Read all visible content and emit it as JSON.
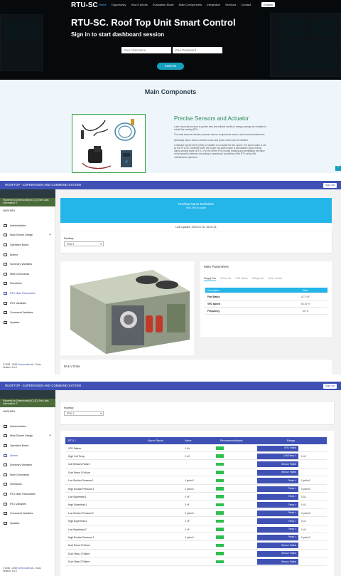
{
  "landing": {
    "brand": "RTU-SC",
    "nav": [
      "Home",
      "Opportunity",
      "How it Works",
      "Evaluation Mode",
      "Main Components",
      "Integration",
      "Services",
      "Contact"
    ],
    "language": "English",
    "title": "RTU-SC. Roof Top Unit Smart Control",
    "subtitle": "Sign in to start dashboard session",
    "username_placeholder": "Your Username",
    "password_placeholder": "Your Password",
    "signin_label": "SIGN IN",
    "components_title": "Main Componets",
    "sensors_title": "Precise Sensors and Actuator",
    "sensors_paragraphs": [
      "A set of precise sensors to get the best and reliable results in energy savings are installed to retrofit the existing RTU.",
      "The main sensors includes pressure sensor, temperature sensor, and current transformers.",
      "Optionally indoor carbon dioxide sensor and power meter can be installed.",
      "A Variable Speed Drive (VSD) is installed to modulate the fan speed. The speed value is set by the RTU-SC controller when the proper fan speed value is calculated to save energy during cooling mode of RTU. For the others RTU modes (heating and ventilating) the value of fan speed is retrieved according to operational conditions of the RTU set by the maintenance operators."
    ]
  },
  "dashboard": {
    "header_title": "ROOFTOP - SUPERVISION AND COMMAND SYSTEM",
    "signout_label": "Sign out",
    "logo_text": "Powered by Greenovate(UC) (C) Sim Labs Information IT",
    "user_label": "MARKMEN",
    "sidebar": [
      "Administration",
      "Main Screen Design",
      "Operation Board",
      "Alarms",
      "Summary Variables",
      "Main Commands",
      "Schedules",
      "RTU Main Parameters",
      "RTU Variables",
      "Command Variables",
      "Updates"
    ],
    "footer_copyright": "© 2015 - 2019",
    "footer_company": "GreenovateLab",
    "footer_rest": "- Tools",
    "footer_version": "Version: 1.6.5",
    "rooftop_label": "Rooftop:",
    "rooftop_value_1": "RTU 2",
    "rooftop_value_2": "RTU 1",
    "banner_title": "Rooftop Name Definition",
    "banner_sub": "Hold ARA no guide",
    "last_update": "Last Update: 2020-07-31 16:20:31",
    "params_title": "Main Parameters",
    "param_tabs": [
      "Supply Fan",
      "Return Air",
      "VSD Status",
      "Refrigerant",
      "Other Values"
    ],
    "param_table_header": [
      "Description",
      "Value"
    ],
    "param_rows": [
      {
        "k": "Fan Status",
        "v": "ACTIVE"
      },
      {
        "k": "VFD Speed",
        "v": "58.33 %"
      },
      {
        "k": "Frequency",
        "v": "35 Hz"
      }
    ],
    "mv_title": "M & V Data",
    "status_header": [
      "RTU 1",
      "Alarm Status",
      "Value",
      "Recommendations",
      "Range"
    ],
    "status_rows": [
      {
        "name": "VFD Failure",
        "value": "0 Hz",
        "range": "VFD Failed",
        "rv": ""
      },
      {
        "name": "High Coil Temp.",
        "value": "0 oC",
        "range": "Coil Temp >",
        "rv": "0 oC"
      },
      {
        "name": "Coil Sensors Failure",
        "value": "",
        "range": "Sensor Failed",
        "rv": ""
      },
      {
        "name": "Duct Press 1 Failure",
        "value": "",
        "range": "Sensor Failed",
        "rv": ""
      },
      {
        "name": "Low Suction Pressure 1",
        "value": "0 psi/m2",
        "range": "Press <",
        "rv": "0 psi/m2"
      },
      {
        "name": "High Suction Pressure 1",
        "value": "0 psi/m2",
        "range": "Press >",
        "rv": "0 psi/m2"
      },
      {
        "name": "Low Superheat 1",
        "value": "0 oF",
        "range": "Temp <",
        "rv": "0 oC"
      },
      {
        "name": "High Superheat 1",
        "value": "0 oF",
        "range": "Temp >",
        "rv": "0 oC"
      },
      {
        "name": "Low Suction Pressure 2",
        "value": "0 psi/m2",
        "range": "Press <",
        "rv": "0 psi/m2"
      },
      {
        "name": "High Superheat 2",
        "value": "0 oF",
        "range": "Temp >",
        "rv": "0 oC"
      },
      {
        "name": "Low Superheat 2",
        "value": "0 oF",
        "range": "Temp <",
        "rv": "0 oC"
      },
      {
        "name": "High Suction Pressure 2",
        "value": "0 psi/m2",
        "range": "Press >",
        "rv": "0 psi/m2"
      },
      {
        "name": "Duct Press 2 Failure",
        "value": "",
        "range": "Sensor Failed",
        "rv": ""
      },
      {
        "name": "Duct Temp 1 Failure",
        "value": "",
        "range": "Sensor Failed",
        "rv": ""
      },
      {
        "name": "Duct Temp 2 Failure",
        "value": "",
        "range": "Sensor Failed",
        "rv": ""
      }
    ]
  }
}
